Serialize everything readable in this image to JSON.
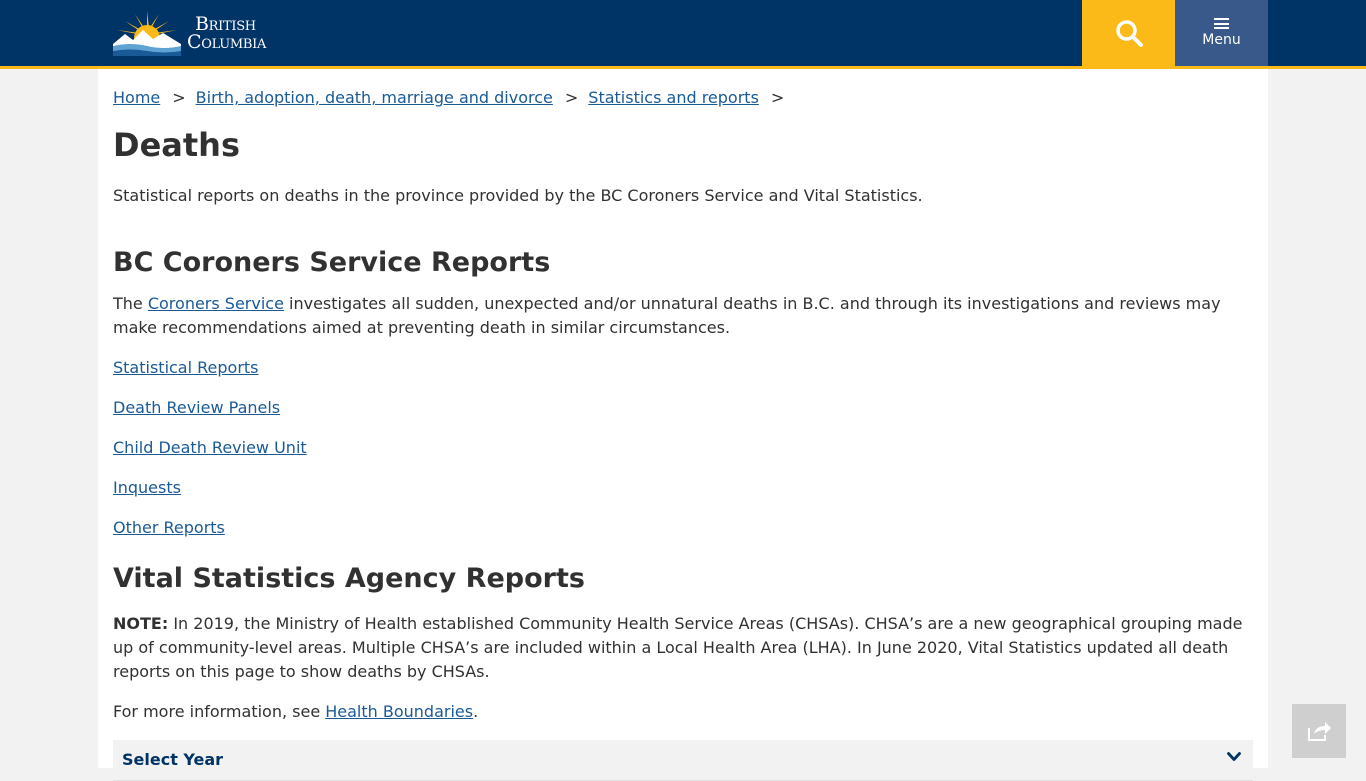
{
  "header": {
    "logo_line1": "British",
    "logo_line2": "Columbia",
    "menu_label": "Menu"
  },
  "breadcrumb": {
    "items": [
      "Home",
      "Birth, adoption, death, marriage and divorce",
      "Statistics and reports"
    ],
    "separator": ">"
  },
  "page": {
    "title": "Deaths",
    "intro": "Statistical reports on deaths in the province provided by the BC Coroners Service and Vital Statistics."
  },
  "coroners": {
    "heading": "BC Coroners Service Reports",
    "text_before": "The ",
    "link": "Coroners Service",
    "text_after": " investigates all sudden, unexpected and/or unnatural deaths in B.C. and through its investigations and reviews may make recommendations aimed at preventing death in similar circumstances.",
    "links": [
      "Statistical Reports",
      "Death Review Panels",
      "Child Death Review Unit",
      "Inquests",
      "Other Reports"
    ]
  },
  "vital": {
    "heading": "Vital Statistics Agency Reports",
    "note_label": "NOTE:",
    "note_text": " In 2019, the Ministry of Health established Community Health Service Areas (CHSAs). CHSA’s are a new geographical grouping made up of community-level areas.  Multiple CHSA’s are included within a Local Health Area (LHA). In June 2020, Vital Statistics updated all death reports on this page to show deaths by CHSAs.",
    "more_before": "For more information, see ",
    "more_link": "Health Boundaries",
    "more_after": "."
  },
  "select_year": {
    "label": "Select Year"
  },
  "colors": {
    "header": "#003366",
    "accent": "#fcba19",
    "menu": "#38598a",
    "link": "#1a5a96"
  },
  "icons": [
    "bc-logo-icon",
    "search-icon",
    "menu-icon",
    "chevron-down-icon",
    "share-icon"
  ]
}
